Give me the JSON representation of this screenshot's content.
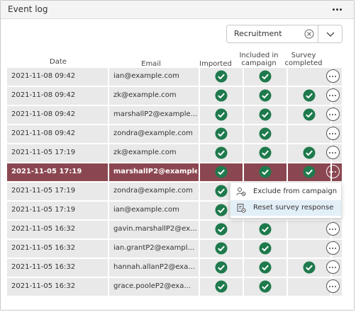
{
  "panel": {
    "title": "Event log"
  },
  "filter": {
    "value": "Recruitment"
  },
  "columns": {
    "date": "Date",
    "email": "Email",
    "imported": "Imported",
    "included_1": "Included in",
    "included_2": "campaign",
    "survey_1": "Survey",
    "survey_2": "completed"
  },
  "rows": [
    {
      "date": "2021-11-08 09:42",
      "email": "ian@example.com",
      "imported": true,
      "included": true,
      "completed": false
    },
    {
      "date": "2021-11-08 09:42",
      "email": "zk@example.com",
      "imported": true,
      "included": true,
      "completed": true
    },
    {
      "date": "2021-11-08 09:42",
      "email": "marshallP2@example...",
      "imported": true,
      "included": true,
      "completed": true
    },
    {
      "date": "2021-11-08 09:42",
      "email": "zondra@example.com",
      "imported": true,
      "included": true,
      "completed": false
    },
    {
      "date": "2021-11-05 17:19",
      "email": "zk@example.com",
      "imported": true,
      "included": true,
      "completed": true
    },
    {
      "date": "2021-11-05 17:19",
      "email": "marshallP2@example...",
      "imported": true,
      "included": true,
      "completed": true,
      "selected": true
    },
    {
      "date": "2021-11-05 17:19",
      "email": "zondra@example.com",
      "imported": true,
      "included": false,
      "completed": false
    },
    {
      "date": "2021-11-05 17:19",
      "email": "ian@example.com",
      "imported": true,
      "included": false,
      "completed": false
    },
    {
      "date": "2021-11-05 16:32",
      "email": "gavin.marshallP2@ex...",
      "imported": true,
      "included": true,
      "completed": false
    },
    {
      "date": "2021-11-05 16:32",
      "email": "ian.grantP2@exampl...",
      "imported": true,
      "included": true,
      "completed": false
    },
    {
      "date": "2021-11-05 16:32",
      "email": "hannah.allanP2@exa...",
      "imported": true,
      "included": true,
      "completed": true
    },
    {
      "date": "2021-11-05 16:32",
      "email": "grace.pooleP2@exa...",
      "imported": true,
      "included": true,
      "completed": false
    }
  ],
  "context_menu": {
    "items": [
      {
        "label": "Exclude from campaign",
        "icon": "exclude-person-icon"
      },
      {
        "label": "Reset survey response",
        "icon": "reset-survey-icon",
        "highlighted": true
      }
    ]
  },
  "colors": {
    "selected_row": "#8b4751",
    "check": "#1e7a4c",
    "row_bg": "#e9e9e9",
    "menu_highlight": "#e3eff6"
  }
}
